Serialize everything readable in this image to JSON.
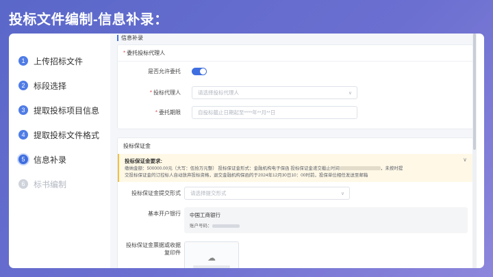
{
  "page": {
    "title": "投标文件编制-信息补录："
  },
  "steps": [
    {
      "num": "1",
      "label": "上传招标文件",
      "state": "done"
    },
    {
      "num": "2",
      "label": "标段选择",
      "state": "done"
    },
    {
      "num": "3",
      "label": "提取投标项目信息",
      "state": "done"
    },
    {
      "num": "4",
      "label": "提取投标文件格式",
      "state": "done"
    },
    {
      "num": "5",
      "label": "信息补录",
      "state": "active"
    },
    {
      "num": "6",
      "label": "标书编制",
      "state": "disabled"
    }
  ],
  "section": {
    "title": "信息补录"
  },
  "agent_panel": {
    "title": "委托投标代理人",
    "allow_label": "是否允许委托",
    "allow_value": true,
    "agent_label": "投标代理人",
    "agent_placeholder": "请选择投标代理人",
    "period_label": "委托期限",
    "period_placeholder": "自投标截止日期起至****年**月**日"
  },
  "deposit_panel": {
    "title": "投标保证金",
    "notice_title": "投标保证金要求:",
    "notice_line1": "缴纳金额：500000.00元（大写：伍拾万元整） 投标保证金形式：金融机构电子保函 投标保证金递交截止时间",
    "notice_line1_tail": "，未按时提",
    "notice_line2": "交投标保证金的订控标人自动放弃投标资格，退交金融机构保函的于2024年12月30日10：00时前，投保单位相任发送至邮箱",
    "form_label": "投标保证金提交形式",
    "form_placeholder": "请选择提交形式",
    "bank_label": "基本开户银行",
    "bank_name": "中国工商银行",
    "bank_acct_label": "账户号码：",
    "upload_label_1": "投标保证金票据或收据",
    "upload_label_2": "复印件"
  },
  "colors": {
    "accent": "#3f6ee0",
    "notice_bg": "#fff8e6",
    "required": "#e5484d"
  }
}
